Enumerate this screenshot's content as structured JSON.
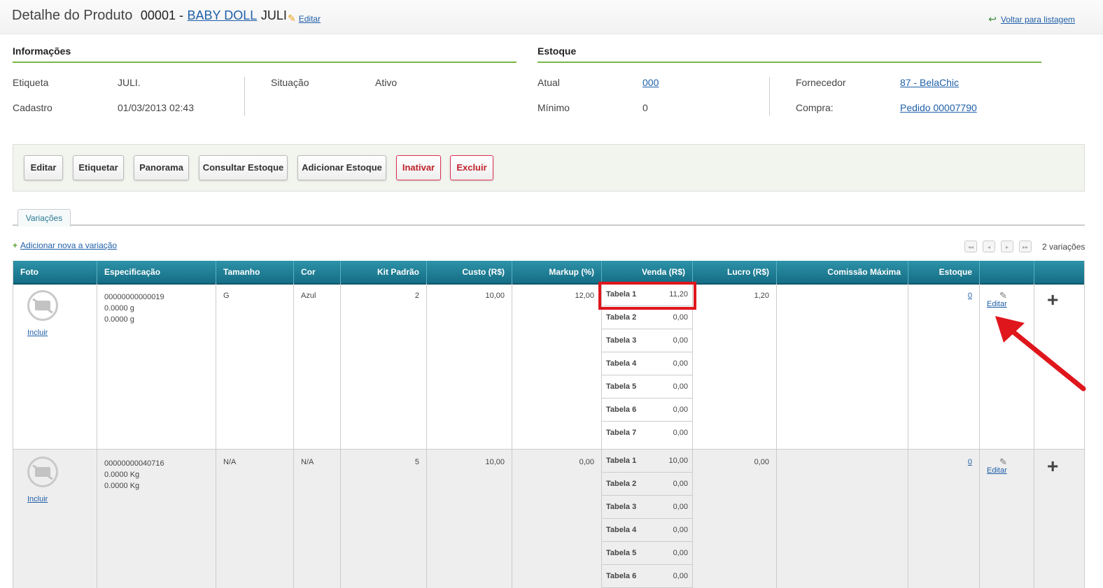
{
  "header": {
    "title": "Detalhe do Produto",
    "code": "00001 -",
    "product_link": "BABY DOLL",
    "product_label": "JULI",
    "edit_label": "Editar",
    "back_label": "Voltar para listagem"
  },
  "info": {
    "title": "Informações",
    "etiqueta_label": "Etiqueta",
    "etiqueta_value": "JULI.",
    "cadastro_label": "Cadastro",
    "cadastro_value": "01/03/2013 02:43",
    "situacao_label": "Situação",
    "situacao_value": "Ativo"
  },
  "estoque": {
    "title": "Estoque",
    "atual_label": "Atual",
    "atual_value": "000",
    "minimo_label": "Mínimo",
    "minimo_value": "0",
    "fornecedor_label": "Fornecedor",
    "fornecedor_value": "87 - BelaChic",
    "compra_label": "Compra:",
    "compra_value": "Pedido 00007790"
  },
  "buttons": [
    "Editar",
    "Etiquetar",
    "Panorama",
    "Consultar Estoque",
    "Adicionar Estoque",
    "Inativar",
    "Excluir"
  ],
  "tab": "Variações",
  "add_variation": "Adicionar nova a variação",
  "variation_count": "2 variações",
  "pager": [
    "◂◂",
    "◂",
    "▸",
    "▸▸"
  ],
  "columns": [
    "Foto",
    "Especificação",
    "Tamanho",
    "Cor",
    "Kit Padrão",
    "Custo (R$)",
    "Markup (%)",
    "Venda (R$)",
    "Lucro (R$)",
    "Comissão Máxima",
    "Estoque"
  ],
  "rows": [
    {
      "incluir": "Incluir",
      "spec": [
        "00000000000019",
        "0.0000 g",
        "0.0000 g"
      ],
      "tamanho": "G",
      "cor": "Azul",
      "kit": "2",
      "custo": "10,00",
      "markup": "12,00",
      "prices": [
        {
          "name": "Tabela 1",
          "value": "11,20"
        },
        {
          "name": "Tabela 2",
          "value": "0,00"
        },
        {
          "name": "Tabela 3",
          "value": "0,00"
        },
        {
          "name": "Tabela 4",
          "value": "0,00"
        },
        {
          "name": "Tabela 5",
          "value": "0,00"
        },
        {
          "name": "Tabela 6",
          "value": "0,00"
        },
        {
          "name": "Tabela 7",
          "value": "0,00"
        }
      ],
      "lucro": "1,20",
      "comissao": "",
      "estoque": "0",
      "edit": "Editar"
    },
    {
      "incluir": "Incluir",
      "spec": [
        "00000000040716",
        "0.0000 Kg",
        "0.0000 Kg"
      ],
      "tamanho": "N/A",
      "cor": "N/A",
      "kit": "5",
      "custo": "10,00",
      "markup": "0,00",
      "prices": [
        {
          "name": "Tabela 1",
          "value": "10,00"
        },
        {
          "name": "Tabela 2",
          "value": "0,00"
        },
        {
          "name": "Tabela 3",
          "value": "0,00"
        },
        {
          "name": "Tabela 4",
          "value": "0,00"
        },
        {
          "name": "Tabela 5",
          "value": "0,00"
        },
        {
          "name": "Tabela 6",
          "value": "0,00"
        }
      ],
      "lucro": "0,00",
      "comissao": "",
      "estoque": "0",
      "edit": "Editar"
    }
  ],
  "colors": {
    "accent": "#7ab648",
    "header_bg": "#1d7f96",
    "danger": "#c0222a",
    "highlight": "#e0161d"
  }
}
